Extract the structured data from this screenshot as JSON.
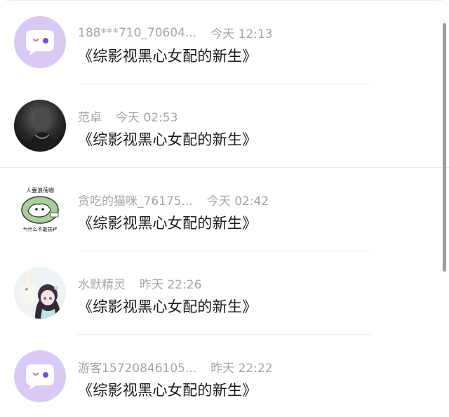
{
  "messages": [
    {
      "name": "188***710_70604...",
      "time": "今天 12:13",
      "text": "《综影视黑心女配的新生》",
      "avatar": "default-purple-chat-avatar"
    },
    {
      "name": "范卓",
      "time": "今天 02:53",
      "text": "《综影视黑心女配的新生》",
      "avatar": "dark-photo-avatar"
    },
    {
      "name": "贪吃的猫咪_76175...",
      "time": "今天 02:42",
      "text": "《综影视黑心女配的新生》",
      "avatar": "cat-sticker-avatar",
      "avatar_text_top": "人要浪荡物",
      "avatar_text_bottom": "为什么不敢质疑"
    },
    {
      "name": "水默精灵",
      "time": "昨天 22:26",
      "text": "《综影视黑心女配的新生》",
      "avatar": "anime-girl-avatar"
    },
    {
      "name": "游客15720846105...",
      "time": "昨天 22:22",
      "text": "《综影视黑心女配的新生》",
      "avatar": "default-purple-chat-avatar"
    }
  ],
  "colors": {
    "default_avatar_bg": "#d9c9f5",
    "name_text": "#a6a6a6",
    "message_text": "#1a1a1a"
  }
}
